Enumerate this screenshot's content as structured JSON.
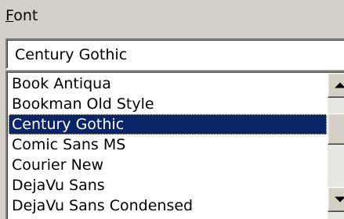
{
  "font_label": {
    "accelerator": "F",
    "rest": "ont"
  },
  "font_input": {
    "value": "Century Gothic"
  },
  "font_list": {
    "items": [
      {
        "label": "Book Antiqua",
        "selected": false
      },
      {
        "label": "Bookman Old Style",
        "selected": false
      },
      {
        "label": "Century Gothic",
        "selected": true
      },
      {
        "label": "Comic Sans MS",
        "selected": false
      },
      {
        "label": "Courier New",
        "selected": false
      },
      {
        "label": "DejaVu Sans",
        "selected": false
      },
      {
        "label": "DejaVu Sans Condensed",
        "selected": false
      }
    ]
  },
  "icons": {
    "scroll_up": "up-arrow-icon",
    "scroll_down": "down-arrow-icon"
  },
  "colors": {
    "dialog_bg": "#d4d0c8",
    "selection_bg": "#0a246a",
    "selection_text": "#ffffff"
  }
}
